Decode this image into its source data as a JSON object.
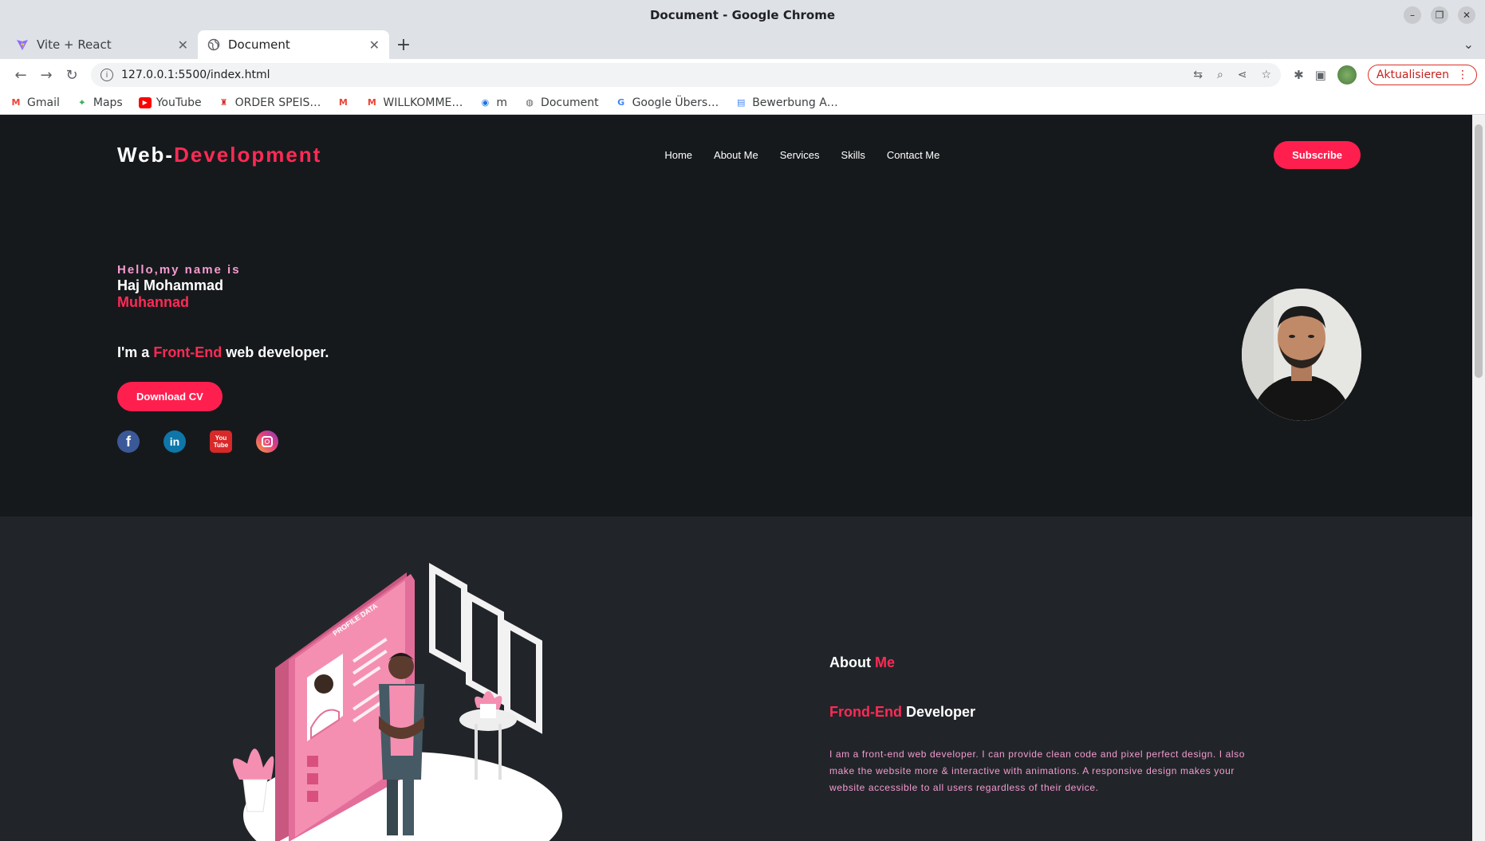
{
  "window": {
    "title": "Document - Google Chrome"
  },
  "tabs": [
    {
      "label": "Vite + React"
    },
    {
      "label": "Document"
    }
  ],
  "toolbar": {
    "url": "127.0.0.1:5500/index.html",
    "update_label": "Aktualisieren"
  },
  "bookmarks": [
    {
      "label": "Gmail",
      "icon": "gmail-icon"
    },
    {
      "label": "Maps",
      "icon": "maps-icon"
    },
    {
      "label": "YouTube",
      "icon": "youtube-icon"
    },
    {
      "label": "ORDER SPEIS…",
      "icon": "order-icon"
    },
    {
      "label": "",
      "icon": "gmail-icon"
    },
    {
      "label": "WILLKOMME…",
      "icon": "gmail-icon"
    },
    {
      "label": "m",
      "icon": "circle-icon"
    },
    {
      "label": "Document",
      "icon": "globe-icon"
    },
    {
      "label": "Google Übers…",
      "icon": "translate-icon"
    },
    {
      "label": "Bewerbung A…",
      "icon": "docs-icon"
    }
  ],
  "site": {
    "logo_prefix": "Web-",
    "logo_accent": "Development",
    "menu": [
      "Home",
      "About Me",
      "Services",
      "Skills",
      "Contact Me"
    ],
    "subscribe_label": "Subscribe",
    "hero": {
      "hello": "Hello,my name is",
      "first_name": "Haj Mohammad",
      "last_name": "Muhannad",
      "role_prefix": "I'm a ",
      "role_accent": "Front-End",
      "role_suffix": " web developer.",
      "download_label": "Download CV"
    },
    "about": {
      "title_prefix": "About ",
      "title_accent": "Me",
      "sub_accent": "Frond-End",
      "sub_suffix": " Developer",
      "description": "I am a front-end web developer. I can provide clean code and pixel perfect design. I also make the website more & interactive with animations. A responsive design makes your website accessible to all users regardless of their device.",
      "illustration_text": "PROFILE DATA"
    }
  },
  "colors": {
    "accent": "#ff2a55",
    "pink_text": "#f59bd1",
    "hero_bg": "#16191c",
    "about_bg": "#212529"
  }
}
